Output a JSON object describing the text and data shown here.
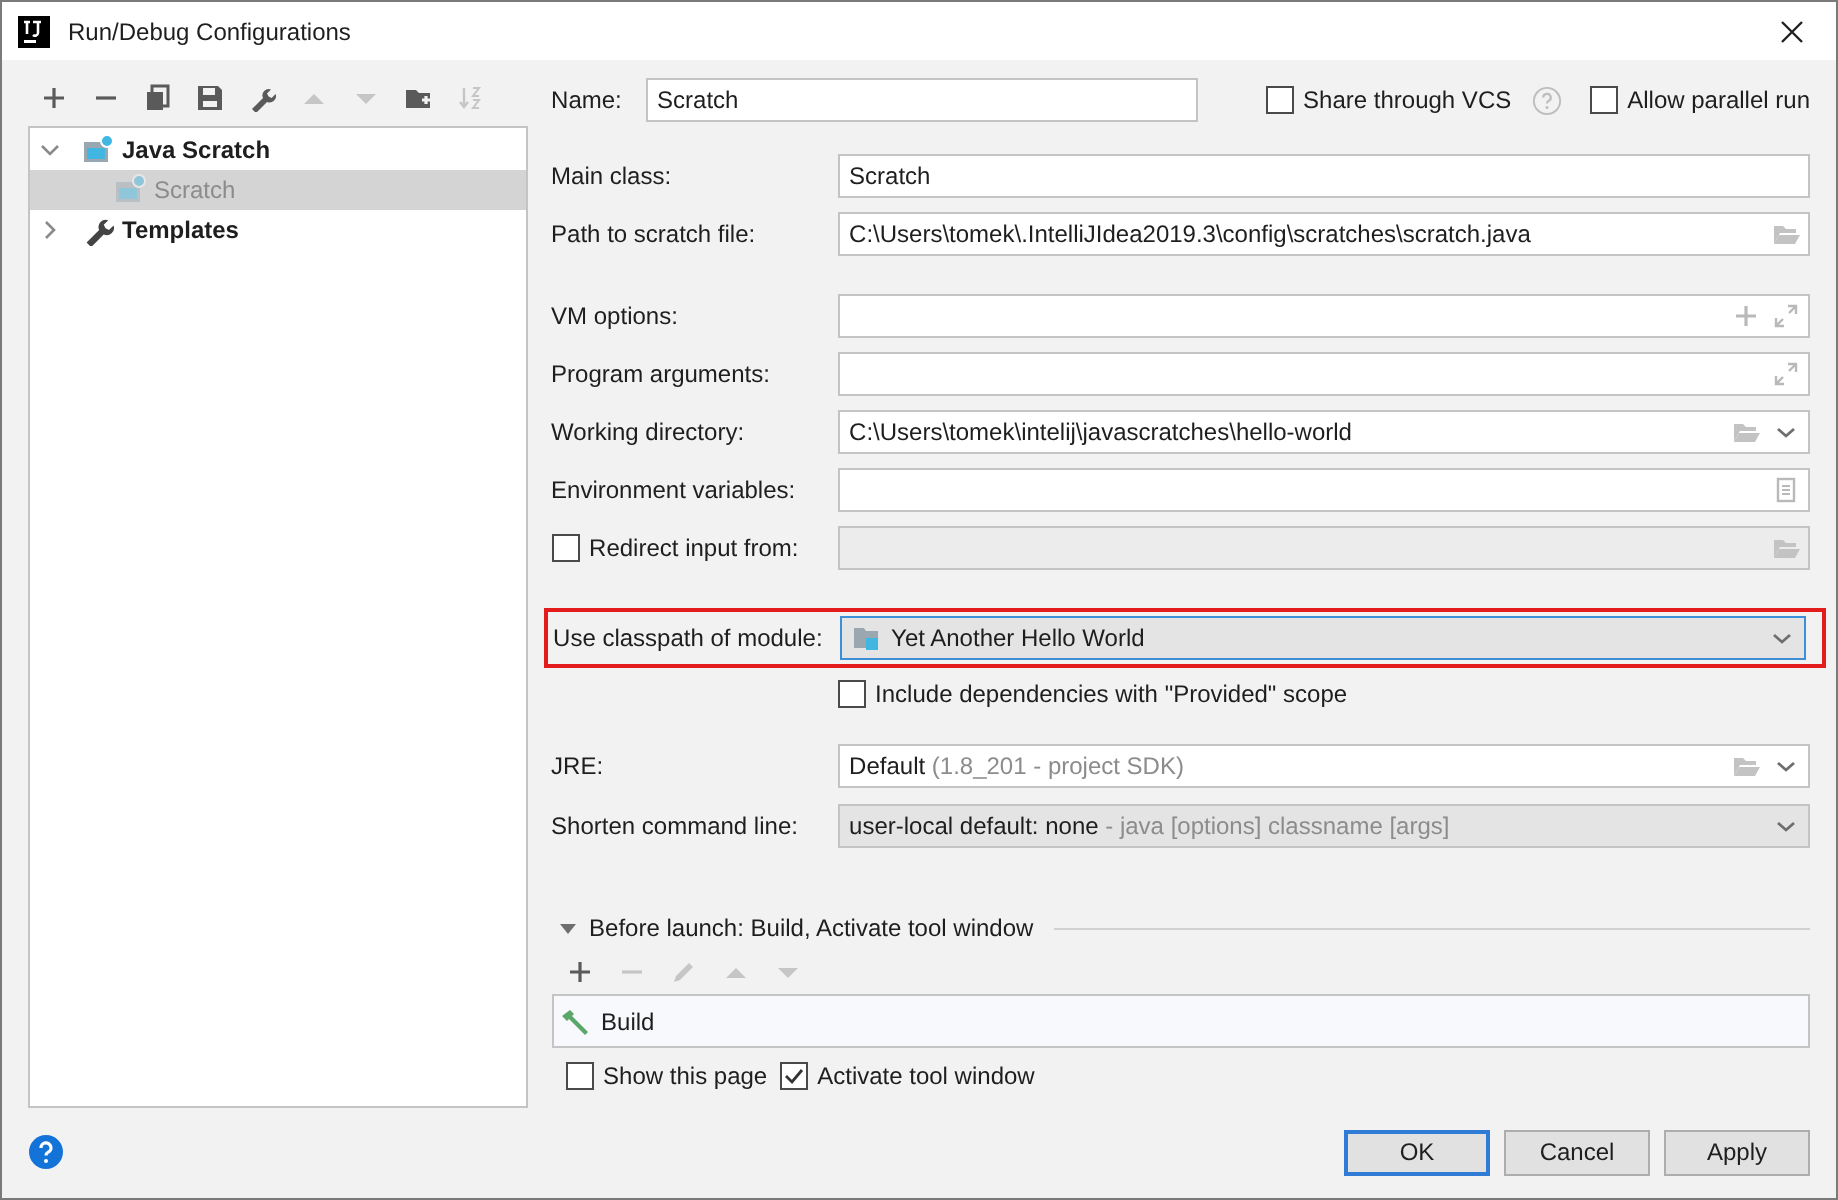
{
  "window": {
    "title": "Run/Debug Configurations"
  },
  "toolbar": [
    {
      "kind": "add",
      "disabled": false
    },
    {
      "kind": "remove",
      "disabled": false
    },
    {
      "kind": "copy",
      "disabled": false
    },
    {
      "kind": "save",
      "disabled": false
    },
    {
      "kind": "wrench",
      "disabled": false
    },
    {
      "kind": "up",
      "disabled": true
    },
    {
      "kind": "down",
      "disabled": true
    },
    {
      "kind": "folder",
      "disabled": false
    },
    {
      "kind": "sort",
      "disabled": true
    }
  ],
  "tree": [
    {
      "label": "Java Scratch",
      "kind": "scratch",
      "expanded": true,
      "selected": false,
      "temporary": false,
      "children": [
        {
          "label": "Scratch",
          "kind": "scratch",
          "selected": true,
          "temporary": true
        }
      ]
    },
    {
      "label": "Templates",
      "kind": "wrench",
      "expanded": false,
      "selected": false,
      "temporary": false
    }
  ],
  "name": {
    "label": "Name:",
    "value": "Scratch"
  },
  "options": [
    {
      "label": "Share through VCS",
      "checked": false,
      "help": true
    },
    {
      "label": "Allow parallel run",
      "checked": false,
      "help": false
    }
  ],
  "field_groups": [
    {
      "rows": [
        {
          "kind": "text",
          "label": "Main class:",
          "value": "Scratch",
          "disabled": false
        },
        {
          "kind": "file",
          "label": "Path to scratch file:",
          "value": "C:\\Users\\tomek\\.IntelliJIdea2019.3\\config\\scratches\\scratch.java",
          "disabled": false
        }
      ]
    },
    {
      "rows": [
        {
          "kind": "options",
          "label": "VM options:",
          "disabled": false
        },
        {
          "kind": "expandable",
          "label": "Program arguments:",
          "disabled": false
        },
        {
          "kind": "directory",
          "label": "Working directory:",
          "value": "C:\\Users\\tomek\\intelij\\javascratches\\hello-world",
          "disabled": false
        },
        {
          "kind": "env",
          "label": "Environment variables:",
          "disabled": false
        },
        {
          "kind": "checkbox-file",
          "label": "Redirect input from:",
          "checked": false,
          "disabled": true
        }
      ]
    }
  ],
  "module": {
    "label": "Use classpath of module:",
    "value": "Yet Another Hello World",
    "highlighted": true
  },
  "include_deps": {
    "label": "Include dependencies with \"Provided\" scope",
    "checked": false
  },
  "jre": {
    "kind": "editable-combo",
    "label": "JRE:",
    "value": "Default",
    "hint": "(1.8_201 - project SDK)"
  },
  "shorten": {
    "kind": "combo",
    "label": "Shorten command line:",
    "value": "user-local default: none",
    "hint": "- java [options] classname [args]"
  },
  "before_launch": {
    "title": "Before launch: Build, Activate tool window",
    "expanded": true,
    "toolbar": [
      {
        "kind": "add",
        "disabled": false
      },
      {
        "kind": "remove",
        "disabled": true
      },
      {
        "kind": "edit",
        "disabled": true
      },
      {
        "kind": "up",
        "disabled": true
      },
      {
        "kind": "down",
        "disabled": true
      }
    ],
    "tasks": [
      {
        "label": "Build"
      }
    ]
  },
  "launch_options": [
    {
      "label": "Show this page",
      "checked": false
    },
    {
      "label": "Activate tool window",
      "checked": true
    }
  ],
  "buttons": [
    {
      "label": "OK",
      "default": true
    },
    {
      "label": "Cancel",
      "default": false
    },
    {
      "label": "Apply",
      "default": false
    }
  ]
}
